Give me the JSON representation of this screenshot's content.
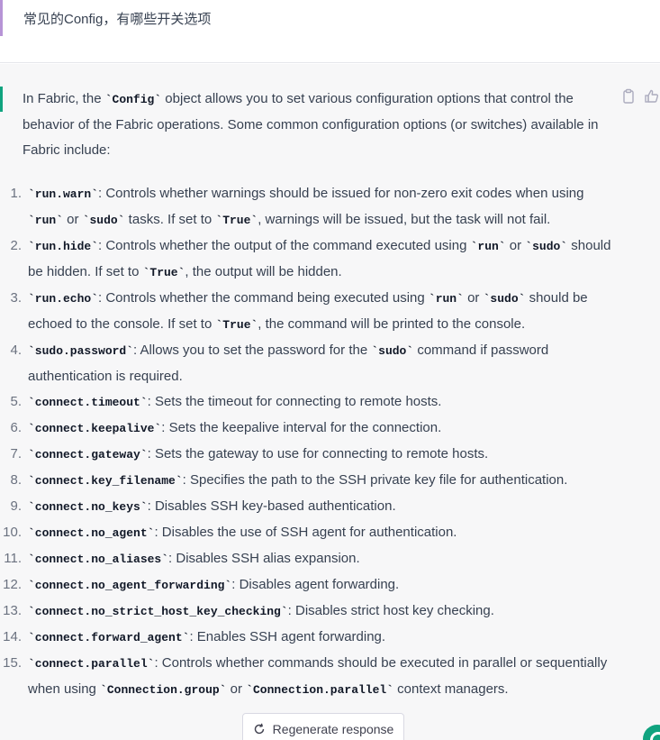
{
  "user_message": {
    "text": "常见的Config，有哪些开关选项"
  },
  "assistant_message": {
    "intro": [
      {
        "t": "In Fabric, the "
      },
      {
        "code": "`Config`"
      },
      {
        "t": " object allows you to set various configuration options that control the behavior of the Fabric operations. Some common configuration options (or switches) available in Fabric include:"
      }
    ],
    "options": [
      {
        "num": "1.",
        "parts": [
          {
            "code": "`run.warn`"
          },
          {
            "t": ": Controls whether warnings should be issued for non-zero exit codes when using "
          },
          {
            "code": "`run`"
          },
          {
            "t": " or "
          },
          {
            "code": "`sudo`"
          },
          {
            "t": " tasks. If set to "
          },
          {
            "code": "`True`"
          },
          {
            "t": ", warnings will be issued, but the task will not fail."
          }
        ]
      },
      {
        "num": "2.",
        "parts": [
          {
            "code": "`run.hide`"
          },
          {
            "t": ": Controls whether the output of the command executed using "
          },
          {
            "code": "`run`"
          },
          {
            "t": " or "
          },
          {
            "code": "`sudo`"
          },
          {
            "t": " should be hidden. If set to "
          },
          {
            "code": "`True`"
          },
          {
            "t": ", the output will be hidden."
          }
        ]
      },
      {
        "num": "3.",
        "parts": [
          {
            "code": "`run.echo`"
          },
          {
            "t": ": Controls whether the command being executed using "
          },
          {
            "code": "`run`"
          },
          {
            "t": " or "
          },
          {
            "code": "`sudo`"
          },
          {
            "t": " should be echoed to the console. If set to "
          },
          {
            "code": "`True`"
          },
          {
            "t": ", the command will be printed to the console."
          }
        ]
      },
      {
        "num": "4.",
        "parts": [
          {
            "code": "`sudo.password`"
          },
          {
            "t": ": Allows you to set the password for the "
          },
          {
            "code": "`sudo`"
          },
          {
            "t": " command if password authentication is required."
          }
        ]
      },
      {
        "num": "5.",
        "parts": [
          {
            "code": "`connect.timeout`"
          },
          {
            "t": ": Sets the timeout for connecting to remote hosts."
          }
        ]
      },
      {
        "num": "6.",
        "parts": [
          {
            "code": "`connect.keepalive`"
          },
          {
            "t": ": Sets the keepalive interval for the connection."
          }
        ]
      },
      {
        "num": "7.",
        "parts": [
          {
            "code": "`connect.gateway`"
          },
          {
            "t": ": Sets the gateway to use for connecting to remote hosts."
          }
        ]
      },
      {
        "num": "8.",
        "parts": [
          {
            "code": "`connect.key_filename`"
          },
          {
            "t": ": Specifies the path to the SSH private key file for authentication."
          }
        ]
      },
      {
        "num": "9.",
        "parts": [
          {
            "code": "`connect.no_keys`"
          },
          {
            "t": ": Disables SSH key-based authentication."
          }
        ]
      },
      {
        "num": "10.",
        "parts": [
          {
            "code": "`connect.no_agent`"
          },
          {
            "t": ": Disables the use of SSH agent for authentication."
          }
        ]
      },
      {
        "num": "11.",
        "parts": [
          {
            "code": "`connect.no_aliases`"
          },
          {
            "t": ": Disables SSH alias expansion."
          }
        ]
      },
      {
        "num": "12.",
        "parts": [
          {
            "code": "`connect.no_agent_forwarding`"
          },
          {
            "t": ": Disables agent forwarding."
          }
        ]
      },
      {
        "num": "13.",
        "parts": [
          {
            "code": "`connect.no_strict_host_key_checking`"
          },
          {
            "t": ": Disables strict host key checking."
          }
        ]
      },
      {
        "num": "14.",
        "parts": [
          {
            "code": "`connect.forward_agent`"
          },
          {
            "t": ": Enables SSH agent forwarding."
          }
        ]
      },
      {
        "num": "15.",
        "parts": [
          {
            "code": "`connect.parallel`"
          },
          {
            "t": ": Controls whether commands should be executed in parallel or sequentially when using "
          },
          {
            "code": "`Connection.group`"
          },
          {
            "t": " or "
          },
          {
            "code": "`Connection.parallel`"
          },
          {
            "t": " context managers."
          }
        ]
      }
    ]
  },
  "actions": {
    "copy_icon": "clipboard-icon",
    "like_icon": "thumbs-up-icon"
  },
  "regenerate": {
    "label": "Regenerate response",
    "icon": "refresh-icon"
  },
  "colors": {
    "user_accent": "#b794d6",
    "assistant_accent": "#10a37f",
    "assistant_bg": "#f7f7f8"
  }
}
